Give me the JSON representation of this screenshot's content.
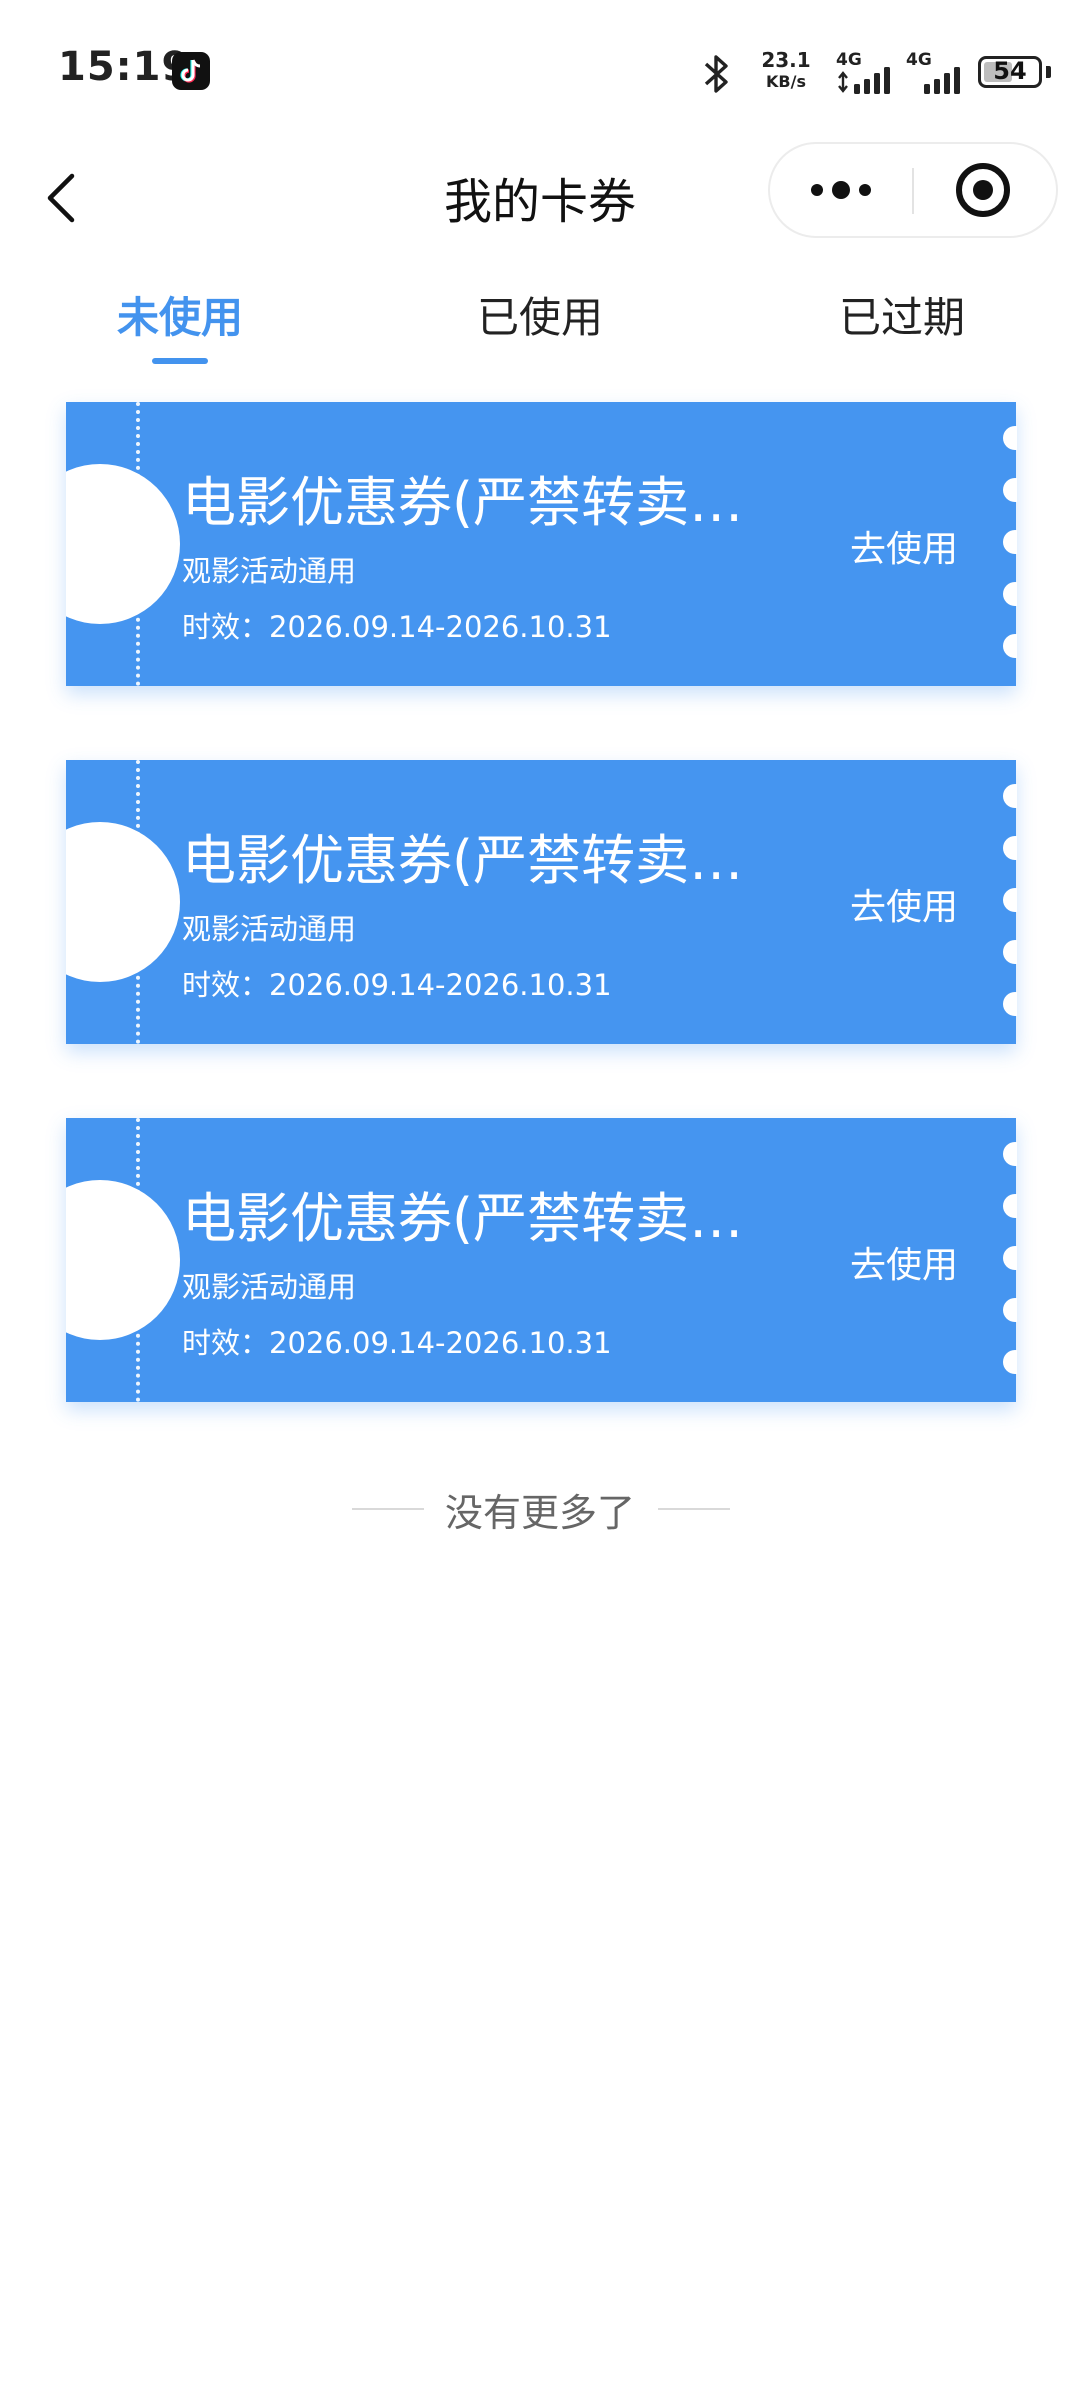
{
  "status_bar": {
    "time": "15:19",
    "net_speed_value": "23.1",
    "net_speed_unit": "KB/s",
    "signal_1_label": "4G",
    "signal_2_label": "4G",
    "battery_level": "54",
    "icons": [
      "tiktok-icon",
      "bluetooth-icon",
      "signal-icon",
      "battery-icon"
    ]
  },
  "nav": {
    "title": "我的卡券",
    "icons": [
      "back-icon",
      "more-icon",
      "close-miniprogram-icon"
    ]
  },
  "tabs": [
    {
      "label": "未使用",
      "active": true
    },
    {
      "label": "已使用",
      "active": false
    },
    {
      "label": "已过期",
      "active": false
    }
  ],
  "coupons": [
    {
      "title": "电影优惠券(严禁转卖…",
      "scope": "观影活动通用",
      "validity": "时效：2026.09.14-2026.10.31",
      "action": "去使用"
    },
    {
      "title": "电影优惠券(严禁转卖…",
      "scope": "观影活动通用",
      "validity": "时效：2026.09.14-2026.10.31",
      "action": "去使用"
    },
    {
      "title": "电影优惠券(严禁转卖…",
      "scope": "观影活动通用",
      "validity": "时效：2026.09.14-2026.10.31",
      "action": "去使用"
    }
  ],
  "footer": {
    "no_more": "没有更多了"
  },
  "colors": {
    "accent": "#4393ee",
    "coupon_bg": "#4595f0"
  }
}
